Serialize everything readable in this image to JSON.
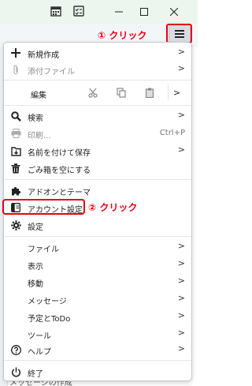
{
  "annotations": {
    "step1": "① クリック",
    "step2": "② クリック",
    "color": "#e60012"
  },
  "background": {
    "bottom_text": "メッセージの作成"
  },
  "menu": {
    "new": "新規作成",
    "attach": "添付ファイル",
    "edit": "編集",
    "search": "検索",
    "print": "印刷...",
    "print_shortcut": "Ctrl+P",
    "save_as": "名前を付けて保存",
    "empty_trash": "ごみ箱を空にする",
    "addons": "アドオンとテーマ",
    "account_settings": "アカウント設定",
    "settings": "設定",
    "file": "ファイル",
    "view": "表示",
    "go": "移動",
    "message": "メッセージ",
    "events_tasks": "予定とToDo",
    "tools": "ツール",
    "help": "ヘルプ",
    "exit": "終了"
  }
}
